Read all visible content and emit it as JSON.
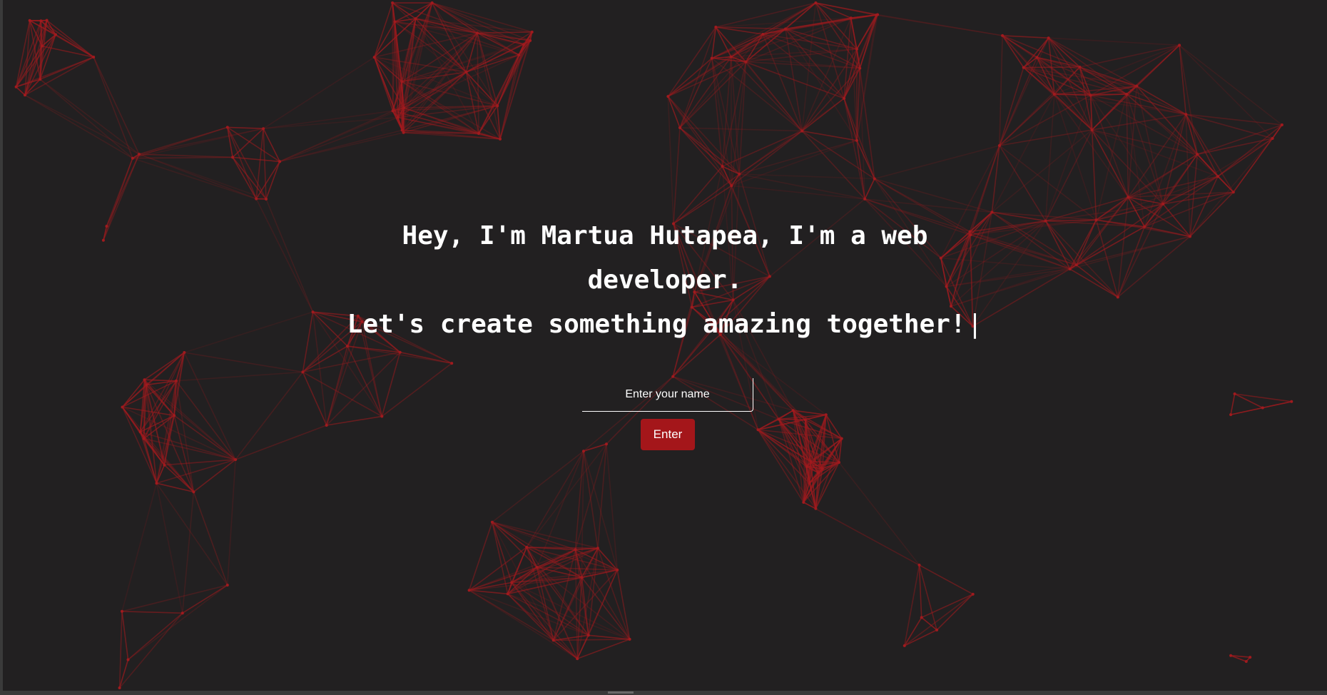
{
  "hero": {
    "line1": "Hey, I'm Martua Hutapea, I'm a web",
    "line2": "developer.",
    "line3": "Let's create something amazing together!",
    "cursor": "|"
  },
  "form": {
    "name_placeholder": "Enter your name",
    "name_value": "",
    "enter_label": "Enter"
  },
  "colors": {
    "background": "#222021",
    "accent": "#a4161a",
    "network": "#a01a1e",
    "text": "#ffffff"
  }
}
